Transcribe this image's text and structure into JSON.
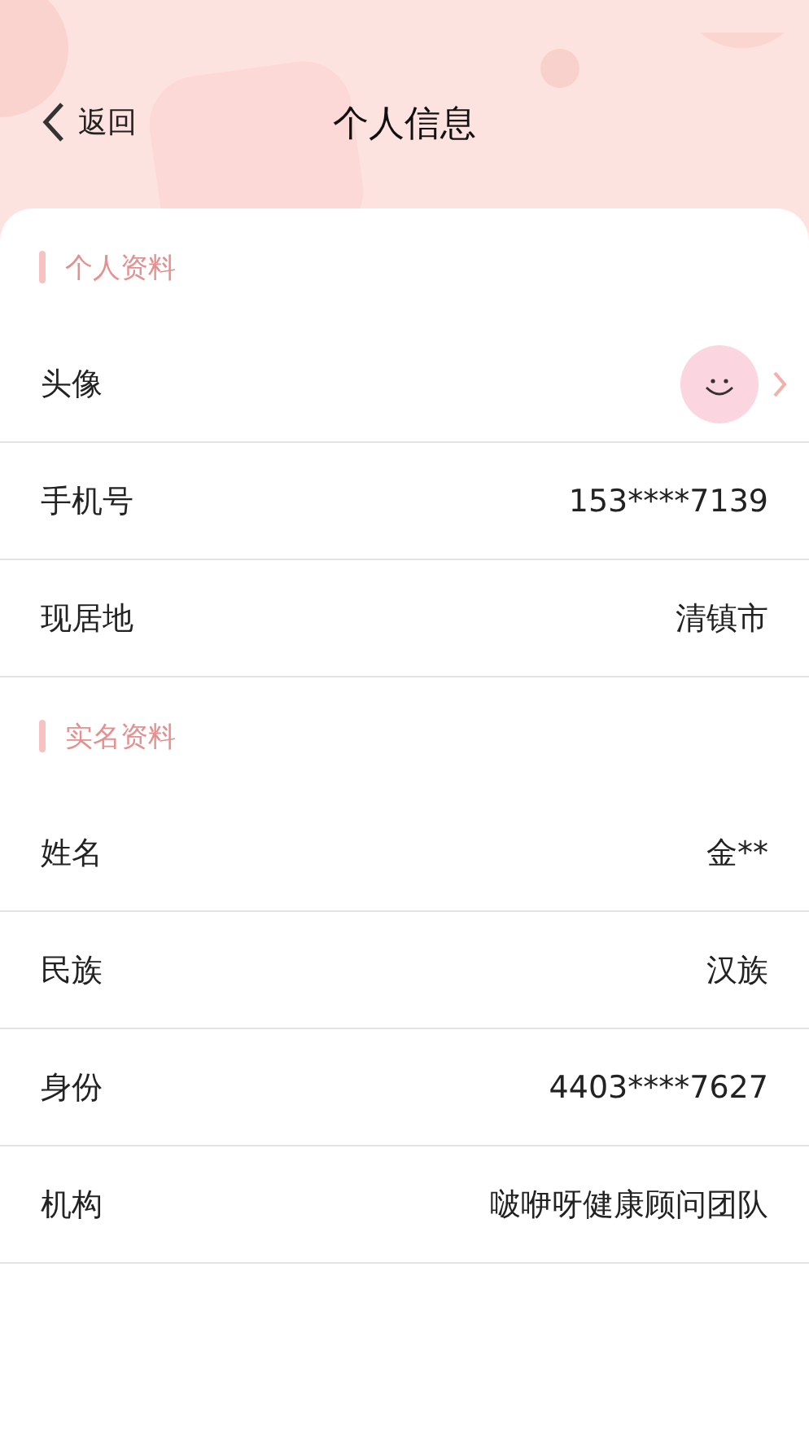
{
  "nav": {
    "back": "返回",
    "title": "个人信息"
  },
  "sections": [
    {
      "title": "个人资料",
      "rows": [
        {
          "kind": "avatar",
          "label": "头像"
        },
        {
          "kind": "text",
          "label": "手机号",
          "value": "153****7139"
        },
        {
          "kind": "text",
          "label": "现居地",
          "value": "清镇市"
        }
      ]
    },
    {
      "title": "实名资料",
      "rows": [
        {
          "kind": "text",
          "label": "姓名",
          "value": "金**"
        },
        {
          "kind": "text",
          "label": "民族",
          "value": "汉族"
        },
        {
          "kind": "text",
          "label": "身份",
          "value": "4403****7627"
        },
        {
          "kind": "text",
          "label": "机构",
          "value": "啵咿呀健康顾问团队"
        }
      ]
    }
  ]
}
